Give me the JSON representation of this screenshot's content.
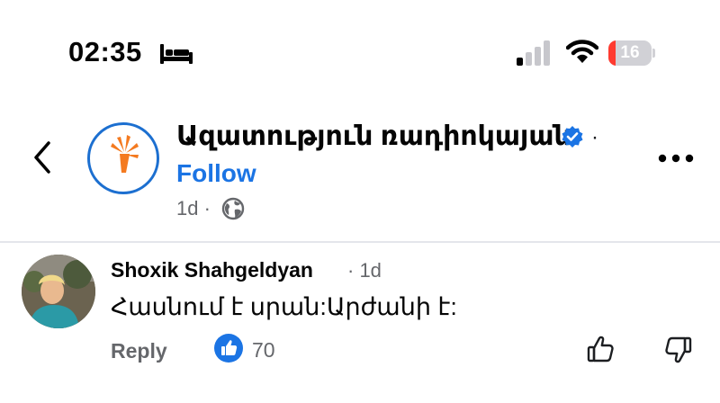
{
  "status_bar": {
    "time": "02:35",
    "battery": "16",
    "battery_level_percent": 16,
    "icons": [
      "bed-icon",
      "cellular-signal-icon",
      "wifi-icon",
      "battery-icon"
    ]
  },
  "header": {
    "back_icon": "chevron-left-icon",
    "page_name": "Ազատություն ռադիոկայան",
    "verified_icon": "verified-badge-icon",
    "separator": "·",
    "follow_label": "Follow",
    "post_age": "1d",
    "meta_separator": "·",
    "audience_icon": "globe-icon",
    "more_icon": "more-horizontal-icon"
  },
  "comment": {
    "author": "Shoxik Shahgeldyan",
    "time": "· 1d",
    "text": "Հասնում է սրան:Արժանի է:",
    "reply_label": "Reply",
    "reaction_icon": "like-reaction-icon",
    "reaction_count": "70",
    "actions": [
      "thumbs-up-icon",
      "thumbs-down-icon"
    ]
  },
  "colors": {
    "accent": "#1b74e4",
    "brand_ring": "#1c6fd0",
    "brand_flame": "#f47a20",
    "battery_low": "#ff3b30",
    "secondary_text": "#65676b"
  }
}
